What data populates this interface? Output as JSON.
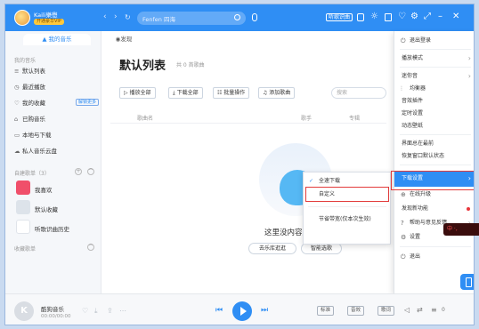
{
  "titlebar": {
    "username": "Kaili樂懋",
    "vip_badge": "开通豪华VIP",
    "search_placeholder": "Fenfen 四海",
    "listen_id": "听歌识曲",
    "win_controls": [
      "⌂",
      "♡",
      "⚙",
      "⤢",
      "–",
      "✕"
    ]
  },
  "tabs": {
    "my_music": "我的音乐",
    "discover": "发现"
  },
  "sidebar": {
    "my_music_head": "我的音乐",
    "items": [
      {
        "icon": "list-icon",
        "label": "默认列表"
      },
      {
        "icon": "clock-icon",
        "label": "最近播放"
      },
      {
        "icon": "heart-icon",
        "label": "我的收藏",
        "badge": "解锁更多"
      },
      {
        "icon": "bag-icon",
        "label": "已购音乐"
      },
      {
        "icon": "monitor-icon",
        "label": "本地与下载"
      },
      {
        "icon": "cloud-icon",
        "label": "私人音乐云盘"
      }
    ],
    "created_head": "自建歌单（3）",
    "playlists": [
      {
        "label": "我喜欢",
        "color": "#f04f6a"
      },
      {
        "label": "默认收藏",
        "color": "#dde3ea"
      },
      {
        "label": "听歌识曲历史",
        "color": "#ffffff"
      }
    ],
    "collected_head": "收藏歌单"
  },
  "main": {
    "title": "默认列表",
    "count": "共 0 首歌曲",
    "toolbar": [
      "播放全部",
      "下载全部",
      "批量操作",
      "添加歌曲"
    ],
    "search_placeholder": "搜索",
    "columns": [
      "歌曲名",
      "歌手",
      "专辑"
    ],
    "empty_text": "这里没内容显示",
    "empty_buttons": [
      "去乐库逛逛",
      "智能选歌"
    ]
  },
  "submenu": {
    "items": [
      "全速下载",
      "自定义",
      "节省带宽(仅本次生效)"
    ],
    "checked_index": 0,
    "highlighted_index": 1
  },
  "menu": {
    "items": [
      {
        "label": "退出登录",
        "icon": "logout-icon"
      },
      {
        "label": "播放模式",
        "arrow": true
      },
      {
        "label": "迷你音",
        "arrow": true
      },
      {
        "label": "均衡器",
        "icon": "equalizer-icon"
      },
      {
        "label": "音效插件"
      },
      {
        "label": "定时设置"
      },
      {
        "label": "动态壁纸"
      },
      {
        "label": "界面总在最前"
      },
      {
        "label": "恢复窗口默认状态"
      },
      {
        "label": "下载设置",
        "arrow": true,
        "active": true
      },
      {
        "label": "在线升级",
        "icon": "upgrade-icon"
      },
      {
        "label": "发现新功能",
        "dot": true
      },
      {
        "label": "帮助与意见反馈",
        "icon": "help-icon",
        "arrow": true
      },
      {
        "label": "设置",
        "icon": "settings-icon"
      },
      {
        "label": "退出",
        "icon": "power-icon"
      }
    ]
  },
  "watermark": "中 ·, ",
  "player": {
    "cover_letter": "K",
    "song": "酷狗音乐",
    "time": "00:00/00:00",
    "quality": "标准",
    "effect": "音效",
    "lyrics": "歌词",
    "queue": "0"
  },
  "colors": {
    "accent": "#2f8ef4",
    "highlight": "#e23b3b"
  }
}
